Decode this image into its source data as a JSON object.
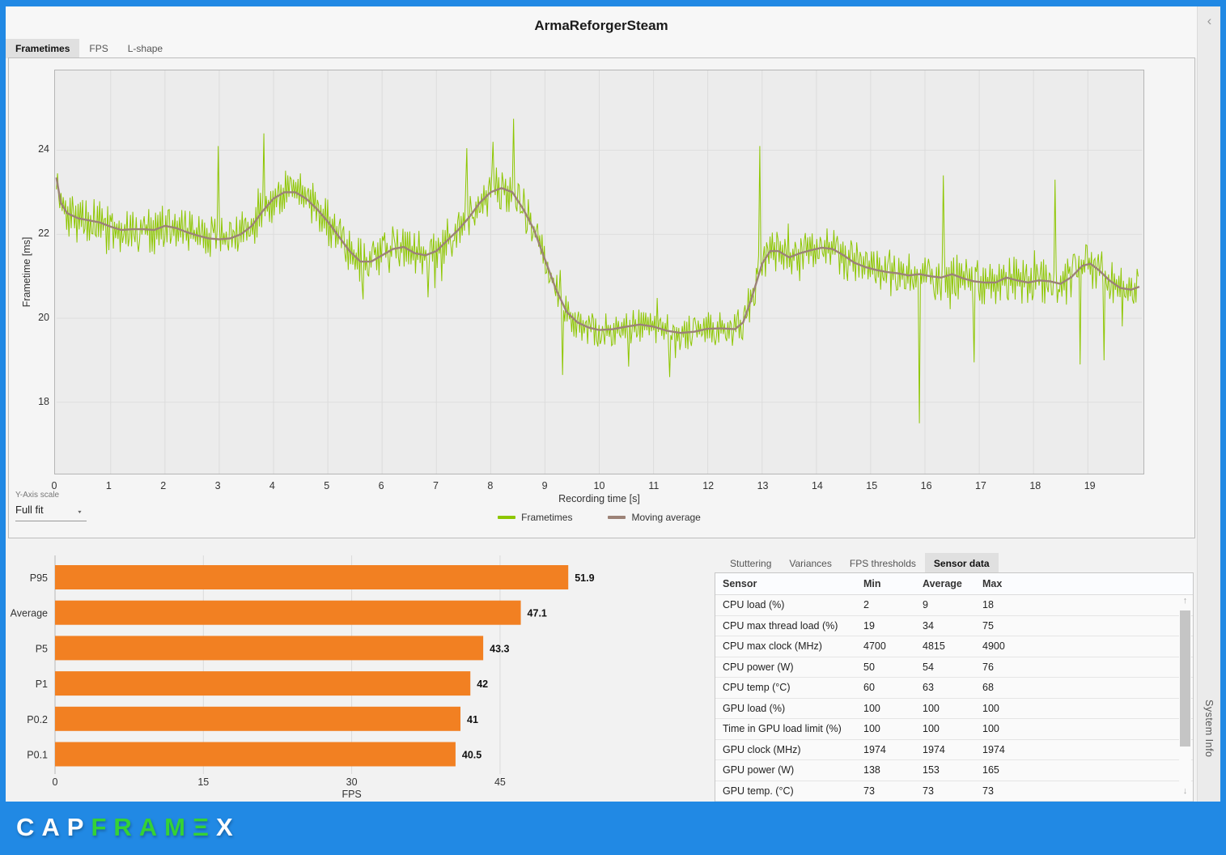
{
  "window": {
    "title": "ArmaReforgerSteam"
  },
  "top_tabs": [
    {
      "label": "Frametimes",
      "selected": true
    },
    {
      "label": "FPS",
      "selected": false
    },
    {
      "label": "L-shape",
      "selected": false
    }
  ],
  "y_axis_scale": {
    "label": "Y-Axis scale",
    "value": "Full fit",
    "caret_icon": "▼"
  },
  "side_panel": {
    "title": "System Info",
    "collapse_icon": "‹"
  },
  "logo": {
    "part1": "CAP",
    "part2": "FRAM",
    "part3": "Ξ",
    "part4": "X"
  },
  "colors": {
    "accent_blue": "#2189e4",
    "frametimes_green": "#8dc600",
    "moving_avg_brown": "#9c8277",
    "bar_orange": "#f28022"
  },
  "chart_data": [
    {
      "type": "line",
      "title": "Frametime graph",
      "xlabel": "Recording time [s]",
      "ylabel": "Frametime [ms]",
      "xlim": [
        0,
        20
      ],
      "ylim": [
        16.3,
        25.9
      ],
      "x_ticks": [
        0,
        1,
        2,
        3,
        4,
        5,
        6,
        7,
        8,
        9,
        10,
        11,
        12,
        13,
        14,
        15,
        16,
        17,
        18,
        19
      ],
      "y_ticks": [
        18,
        20,
        22,
        24
      ],
      "grid": true,
      "legend_position": "bottom",
      "legend": [
        {
          "name": "Frametimes",
          "color": "#8dc600"
        },
        {
          "name": "Moving average",
          "color": "#9c8277"
        }
      ],
      "series": [
        {
          "name": "Moving average",
          "points": [
            [
              0,
              23.35
            ],
            [
              0.08,
              22.75
            ],
            [
              0.2,
              22.5
            ],
            [
              0.4,
              22.38
            ],
            [
              0.6,
              22.33
            ],
            [
              0.8,
              22.28
            ],
            [
              1.0,
              22.18
            ],
            [
              1.2,
              22.1
            ],
            [
              1.4,
              22.12
            ],
            [
              1.6,
              22.12
            ],
            [
              1.8,
              22.1
            ],
            [
              2.0,
              22.2
            ],
            [
              2.2,
              22.15
            ],
            [
              2.4,
              22.05
            ],
            [
              2.6,
              21.97
            ],
            [
              2.8,
              21.9
            ],
            [
              3.0,
              21.88
            ],
            [
              3.2,
              21.9
            ],
            [
              3.4,
              22.0
            ],
            [
              3.6,
              22.2
            ],
            [
              3.8,
              22.55
            ],
            [
              4.0,
              22.85
            ],
            [
              4.2,
              23.0
            ],
            [
              4.4,
              23.0
            ],
            [
              4.6,
              22.85
            ],
            [
              4.8,
              22.6
            ],
            [
              5.0,
              22.3
            ],
            [
              5.2,
              21.95
            ],
            [
              5.4,
              21.6
            ],
            [
              5.6,
              21.35
            ],
            [
              5.8,
              21.35
            ],
            [
              6.0,
              21.5
            ],
            [
              6.2,
              21.65
            ],
            [
              6.4,
              21.7
            ],
            [
              6.6,
              21.55
            ],
            [
              6.8,
              21.5
            ],
            [
              7.0,
              21.6
            ],
            [
              7.2,
              21.85
            ],
            [
              7.4,
              22.1
            ],
            [
              7.6,
              22.4
            ],
            [
              7.8,
              22.75
            ],
            [
              8.0,
              23.0
            ],
            [
              8.2,
              23.1
            ],
            [
              8.4,
              23.0
            ],
            [
              8.6,
              22.6
            ],
            [
              8.8,
              22.1
            ],
            [
              9.0,
              21.4
            ],
            [
              9.2,
              20.7
            ],
            [
              9.4,
              20.15
            ],
            [
              9.6,
              19.9
            ],
            [
              9.8,
              19.78
            ],
            [
              10.0,
              19.72
            ],
            [
              10.25,
              19.74
            ],
            [
              10.5,
              19.8
            ],
            [
              10.75,
              19.85
            ],
            [
              11.0,
              19.8
            ],
            [
              11.25,
              19.7
            ],
            [
              11.5,
              19.65
            ],
            [
              11.75,
              19.68
            ],
            [
              12.0,
              19.75
            ],
            [
              12.25,
              19.76
            ],
            [
              12.5,
              19.74
            ],
            [
              12.65,
              19.9
            ],
            [
              12.8,
              20.45
            ],
            [
              13.0,
              21.3
            ],
            [
              13.15,
              21.6
            ],
            [
              13.3,
              21.6
            ],
            [
              13.5,
              21.45
            ],
            [
              13.7,
              21.55
            ],
            [
              13.9,
              21.62
            ],
            [
              14.1,
              21.68
            ],
            [
              14.3,
              21.65
            ],
            [
              14.5,
              21.5
            ],
            [
              14.7,
              21.32
            ],
            [
              14.9,
              21.22
            ],
            [
              15.1,
              21.15
            ],
            [
              15.3,
              21.1
            ],
            [
              15.5,
              21.07
            ],
            [
              15.7,
              21.02
            ],
            [
              15.9,
              21.05
            ],
            [
              16.1,
              21.0
            ],
            [
              16.3,
              20.97
            ],
            [
              16.5,
              21.05
            ],
            [
              16.7,
              20.95
            ],
            [
              16.9,
              20.88
            ],
            [
              17.1,
              20.85
            ],
            [
              17.3,
              20.85
            ],
            [
              17.5,
              20.97
            ],
            [
              17.7,
              20.9
            ],
            [
              17.9,
              20.85
            ],
            [
              18.1,
              20.9
            ],
            [
              18.3,
              20.88
            ],
            [
              18.5,
              20.82
            ],
            [
              18.7,
              20.98
            ],
            [
              18.9,
              21.25
            ],
            [
              19.05,
              21.3
            ],
            [
              19.2,
              21.15
            ],
            [
              19.4,
              20.9
            ],
            [
              19.6,
              20.72
            ],
            [
              19.8,
              20.68
            ],
            [
              19.95,
              20.75
            ]
          ]
        },
        {
          "name": "Frametimes",
          "derived_from": "Moving average",
          "sample_interval_s": 0.021,
          "t_max": 19.95,
          "seed": 11,
          "noise_envelope": [
            [
              0,
              8.7,
              0.55
            ],
            [
              8.7,
              12.6,
              0.42
            ],
            [
              12.6,
              14.4,
              0.5
            ],
            [
              14.4,
              20,
              0.58
            ]
          ],
          "spikes": [
            [
              0.03,
              23.45
            ],
            [
              2.98,
              24.1
            ],
            [
              3.82,
              24.4
            ],
            [
              5.65,
              20.45
            ],
            [
              6.85,
              20.5
            ],
            [
              7.55,
              24.05
            ],
            [
              8.05,
              24.2
            ],
            [
              8.42,
              24.75
            ],
            [
              9.33,
              18.65
            ],
            [
              10.55,
              18.85
            ],
            [
              11.3,
              18.6
            ],
            [
              12.95,
              24.1
            ],
            [
              15.89,
              17.5
            ],
            [
              16.33,
              23.4
            ],
            [
              16.9,
              18.95
            ],
            [
              18.4,
              23.3
            ],
            [
              18.85,
              18.9
            ],
            [
              19.3,
              19.0
            ]
          ]
        }
      ]
    },
    {
      "type": "bar",
      "orientation": "horizontal",
      "title": "FPS percentiles",
      "categories": [
        "P95",
        "Average",
        "P5",
        "P1",
        "P0.2",
        "P0.1"
      ],
      "values": [
        51.9,
        47.1,
        43.3,
        42,
        41,
        40.5
      ],
      "value_labels": [
        "51.9",
        "47.1",
        "43.3",
        "42",
        "41",
        "40.5"
      ],
      "xlabel": "FPS",
      "x_ticks": [
        0,
        15,
        30,
        45
      ],
      "xlim": [
        0,
        57
      ],
      "grid": true,
      "bar_color": "#f28022"
    }
  ],
  "sensor_panel": {
    "tabs": [
      {
        "label": "Stuttering",
        "selected": false
      },
      {
        "label": "Variances",
        "selected": false
      },
      {
        "label": "FPS thresholds",
        "selected": false
      },
      {
        "label": "Sensor data",
        "selected": true
      }
    ],
    "table": {
      "columns": [
        "Sensor",
        "Min",
        "Average",
        "Max"
      ],
      "rows": [
        [
          "CPU load (%)",
          "2",
          "9",
          "18"
        ],
        [
          "CPU max thread load (%)",
          "19",
          "34",
          "75"
        ],
        [
          "CPU max clock (MHz)",
          "4700",
          "4815",
          "4900"
        ],
        [
          "CPU power (W)",
          "50",
          "54",
          "76"
        ],
        [
          "CPU temp (°C)",
          "60",
          "63",
          "68"
        ],
        [
          "GPU load (%)",
          "100",
          "100",
          "100"
        ],
        [
          "Time in GPU load limit (%)",
          "100",
          "100",
          "100"
        ],
        [
          "GPU clock (MHz)",
          "1974",
          "1974",
          "1974"
        ],
        [
          "GPU power (W)",
          "138",
          "153",
          "165"
        ],
        [
          "GPU temp. (°C)",
          "73",
          "73",
          "73"
        ]
      ],
      "scrollbar": {
        "up_icon": "↑",
        "down_icon": "↓"
      }
    }
  }
}
